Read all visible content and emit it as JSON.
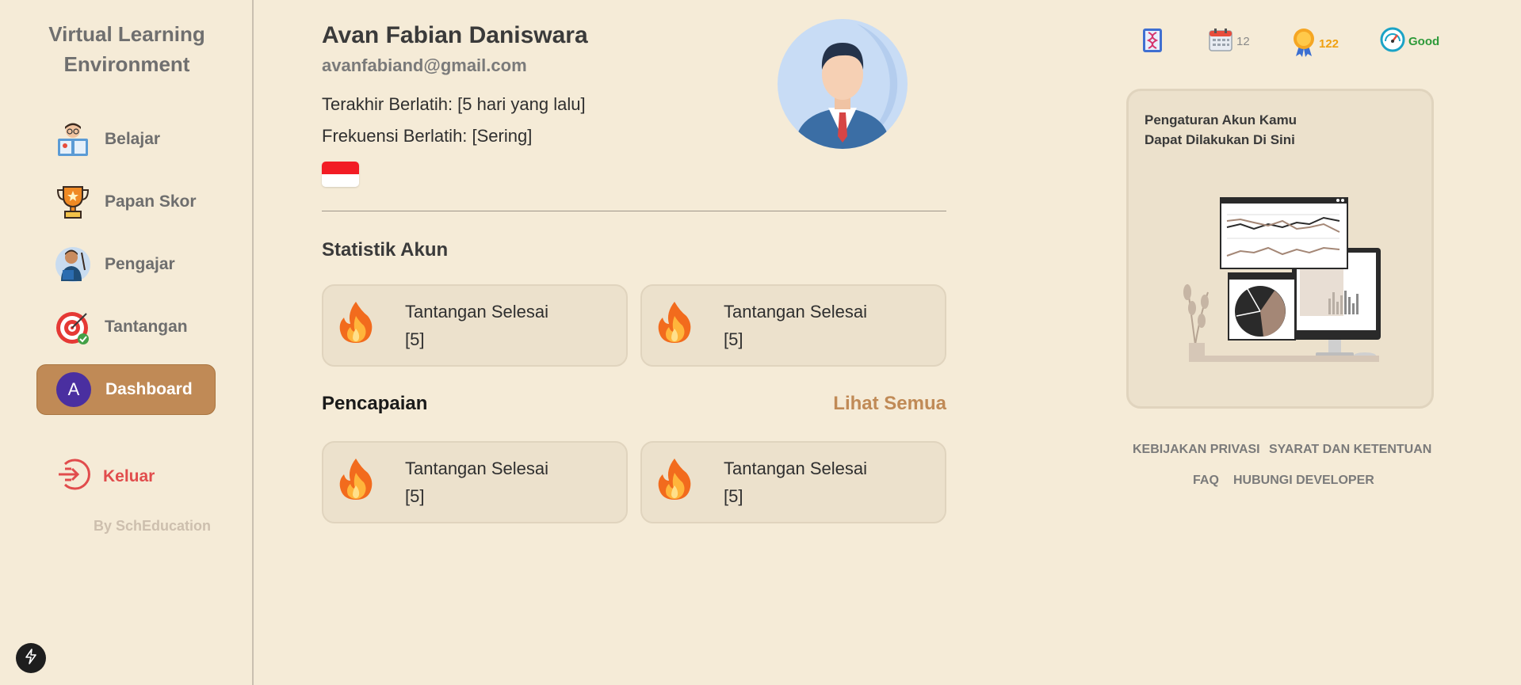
{
  "sidebar": {
    "brand_line1": "Virtual Learning",
    "brand_line2": "Environment",
    "items": [
      {
        "label": "Belajar",
        "icon": "student-reading-icon"
      },
      {
        "label": "Papan Skor",
        "icon": "trophy-icon"
      },
      {
        "label": "Pengajar",
        "icon": "teacher-icon"
      },
      {
        "label": "Tantangan",
        "icon": "target-icon"
      },
      {
        "label": "Dashboard",
        "icon": "avatar-icon",
        "avatar_letter": "A",
        "active": true
      }
    ],
    "logout_label": "Keluar",
    "byline": "By SchEducation"
  },
  "profile": {
    "name": "Avan Fabian Daniswara",
    "email": "avanfabiand@gmail.com",
    "last_practice": "Terakhir Berlatih: [5 hari yang lalu]",
    "frequency": "Frekuensi Berlatih: [Sering]",
    "flag_icon": "indonesia-flag-icon"
  },
  "statistics": {
    "title": "Statistik Akun",
    "cards": [
      {
        "title": "Tantangan Selesai",
        "value": "[5]",
        "icon": "fire-icon"
      },
      {
        "title": "Tantangan Selesai",
        "value": "[5]",
        "icon": "fire-icon"
      }
    ]
  },
  "achievements": {
    "title": "Pencapaian",
    "see_all": "Lihat Semua",
    "cards": [
      {
        "title": "Tantangan Selesai",
        "value": "[5]",
        "icon": "fire-icon"
      },
      {
        "title": "Tantangan Selesai",
        "value": "[5]",
        "icon": "fire-icon"
      }
    ]
  },
  "top_stats": [
    {
      "icon": "dna-book-icon",
      "value": ""
    },
    {
      "icon": "calendar-icon",
      "value": "12"
    },
    {
      "icon": "medal-icon",
      "value": "122",
      "color": "#f0a010"
    },
    {
      "icon": "speedometer-icon",
      "value": "Good",
      "color": "#2e9a3a"
    }
  ],
  "settings_card": {
    "line1": "Pengaturan Akun Kamu",
    "line2": "Dapat Dilakukan Di Sini"
  },
  "footer": {
    "privacy": "KEBIJAKAN PRIVASI",
    "terms": "SYARAT DAN KETENTUAN",
    "faq": "FAQ",
    "contact": "HUBUNGI DEVELOPER"
  },
  "colors": {
    "background": "#f5ebd7",
    "accent": "#c08a56",
    "card": "#ece1cc",
    "logout": "#e14c4c"
  }
}
